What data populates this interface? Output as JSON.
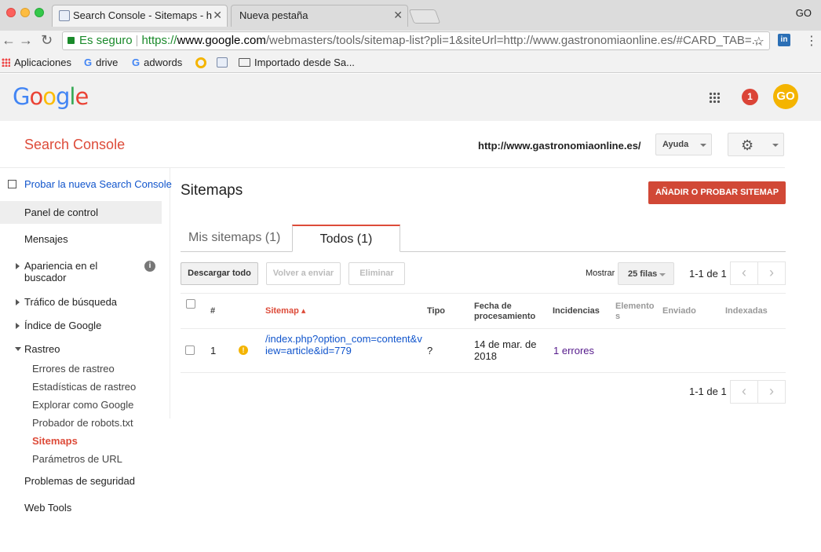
{
  "browser": {
    "tabs": [
      {
        "label": "Search Console - Sitemaps - h",
        "active": true
      },
      {
        "label": "Nueva pestaña",
        "active": false
      }
    ],
    "profile": "GO",
    "secure_label": "Es seguro",
    "url_proto": "https://",
    "url_host": "www.google.com",
    "url_path": "/webmasters/tools/sitemap-list?pli=1&siteUrl=http://www.gastronomiaonline.es/#CARD_TAB=...",
    "bookmarks": [
      {
        "label": "Aplicaciones",
        "icon": "apps-grid-icon"
      },
      {
        "label": "drive",
        "icon": "google-g-icon"
      },
      {
        "label": "adwords",
        "icon": "google-g-icon"
      },
      {
        "label": "",
        "icon": "ring-icon"
      },
      {
        "label": "",
        "icon": "webmaster-icon"
      },
      {
        "label": "Importado desde Sa...",
        "icon": "folder-icon"
      }
    ]
  },
  "google": {
    "logo_letters": [
      "G",
      "o",
      "o",
      "g",
      "l",
      "e"
    ],
    "logo_colors": [
      "#4285f4",
      "#ea4335",
      "#fbbc05",
      "#4285f4",
      "#34a853",
      "#ea4335"
    ],
    "notifications": "1",
    "avatar_initials": "GO"
  },
  "console": {
    "title": "Search Console",
    "site_url": "http://www.gastronomiaonline.es/",
    "help_label": "Ayuda",
    "accent": "#dd4b39"
  },
  "sidebar": {
    "new_console_link": "Probar la nueva Search Console",
    "items": [
      {
        "label": "Panel de control"
      },
      {
        "label": "Mensajes"
      },
      {
        "label": "Apariencia en el buscador"
      },
      {
        "label": "Tráfico de búsqueda"
      },
      {
        "label": "Índice de Google"
      },
      {
        "label": "Rastreo"
      },
      {
        "label": "Problemas de seguridad"
      },
      {
        "label": "Web Tools"
      }
    ],
    "sub_items": [
      {
        "label": "Errores de rastreo"
      },
      {
        "label": "Estadísticas de rastreo"
      },
      {
        "label": "Explorar como Google"
      },
      {
        "label": "Probador de robots.txt"
      },
      {
        "label": "Sitemaps"
      },
      {
        "label": "Parámetros de URL"
      }
    ]
  },
  "main": {
    "page_title": "Sitemaps",
    "add_button": "AÑADIR O PROBAR SITEMAP",
    "tabs": [
      {
        "label": "Mis sitemaps (1)"
      },
      {
        "label": "Todos (1)"
      }
    ],
    "actions": {
      "download": "Descargar todo",
      "resend": "Volver a enviar",
      "delete": "Eliminar"
    },
    "show_label": "Mostrar",
    "rows_per_page": "25 filas",
    "pager_text": "1-1 de 1",
    "columns": [
      "#",
      "Sitemap",
      "Tipo",
      "Fecha de procesamiento",
      "Incidencias",
      "Elementos",
      "Enviado",
      "Indexadas"
    ],
    "rows": [
      {
        "num": "1",
        "sitemap": "/index.php?option_com=content&view=article&id=779",
        "type": "?",
        "date": "14 de mar. de 2018",
        "issues": "1 errores",
        "items": "",
        "submitted": "",
        "indexed": ""
      }
    ]
  }
}
